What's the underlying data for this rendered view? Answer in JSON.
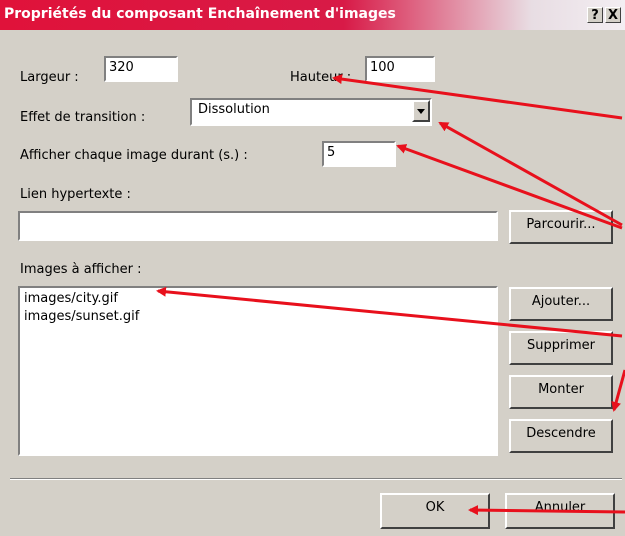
{
  "window": {
    "title": "Propriétés du composant Enchaînement d'images",
    "help_btn": "?",
    "close_btn": "X"
  },
  "form": {
    "width_label": "Largeur :",
    "width_value": "320",
    "height_label": "Hauteur :",
    "height_value": "100",
    "transition_label": "Effet de transition :",
    "transition_value": "Dissolution",
    "duration_label": "Afficher chaque image durant (s.) :",
    "duration_value": "5",
    "link_label": "Lien hypertexte :",
    "link_value": "",
    "browse_button": "Parcourir...",
    "images_label": "Images à afficher :",
    "images": [
      "images/city.gif",
      "images/sunset.gif"
    ]
  },
  "buttons": {
    "add": "Ajouter...",
    "remove": "Supprimer",
    "up": "Monter",
    "down": "Descendre",
    "ok": "OK",
    "cancel": "Annuler"
  },
  "colors": {
    "annotation_arrow": "#e8101c"
  }
}
